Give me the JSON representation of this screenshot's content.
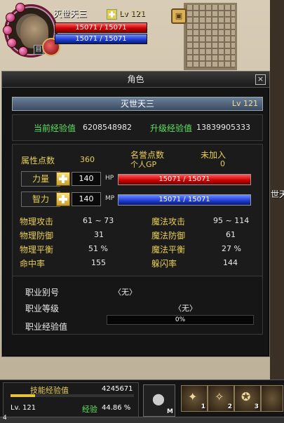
{
  "hud": {
    "name": "灭世天三",
    "level": "Lv 121",
    "hp_text": "15071 / 15071",
    "mp_text": "15071 / 15071",
    "menu_glyph": "目"
  },
  "panel": {
    "title": "角色",
    "close_glyph": "×",
    "char_name": "灭世天三",
    "char_level": "Lv 121",
    "current_exp_label": "当前经验值",
    "current_exp_value": "6208548982",
    "upgrade_exp_label": "升级经验值",
    "upgrade_exp_value": "13839905333",
    "attr_points_label": "属性点数",
    "attr_points_value": "360",
    "fame_label": "名誉点数",
    "fame_value": "未加入",
    "gp_label": "个人GP",
    "gp_value": "0",
    "str_label": "力量",
    "str_value": "140",
    "int_label": "智力",
    "int_value": "140",
    "hp_label": "HP",
    "mp_label": "MP",
    "hp_text": "15071 / 15071",
    "mp_text": "15071 / 15071",
    "stats_left": [
      {
        "label": "物理攻击",
        "value": "61 ~ 73"
      },
      {
        "label": "物理防御",
        "value": "31"
      },
      {
        "label": "物理平衡",
        "value": "51 %"
      },
      {
        "label": "命中率",
        "value": "155"
      }
    ],
    "stats_right": [
      {
        "label": "魔法攻击",
        "value": "95 ~ 114"
      },
      {
        "label": "魔法防御",
        "value": "61"
      },
      {
        "label": "魔法平衡",
        "value": "27 %"
      },
      {
        "label": "躲闪率",
        "value": "144"
      }
    ],
    "job_name_label": "职业别号",
    "job_name_value": "〈无〉",
    "job_level_label": "职业等级",
    "job_level_value": "〈无〉",
    "job_exp_label": "职业经验值",
    "job_exp_value": "0%"
  },
  "bottom": {
    "skill_exp_label": "技能经验值",
    "skill_exp_value": "4245671",
    "skill_exp_fraction": 0.2,
    "level": "Lv. 121",
    "exp_label": "经验",
    "exp_value": "44.86 %",
    "slot_m_label": "M",
    "slot_numbers": [
      "1",
      "2",
      "3"
    ],
    "corner_number": "4",
    "side_text": "世天"
  }
}
